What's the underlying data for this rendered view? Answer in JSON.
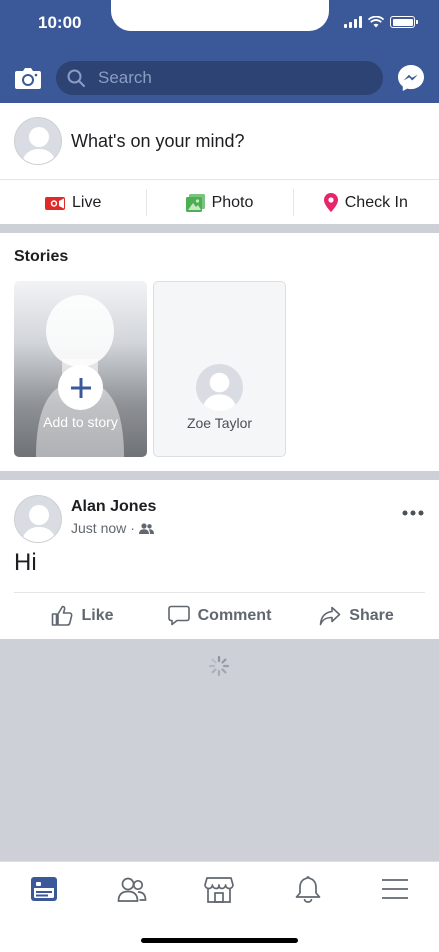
{
  "status_bar": {
    "time": "10:00"
  },
  "header": {
    "search_placeholder": "Search"
  },
  "composer": {
    "prompt": "What's on your mind?",
    "actions": [
      {
        "label": "Live",
        "icon": "video-camera-icon",
        "color": "#e02a2a"
      },
      {
        "label": "Photo",
        "icon": "photo-icon",
        "color": "#4caf50"
      },
      {
        "label": "Check In",
        "icon": "location-pin-icon",
        "color": "#e8246b"
      }
    ]
  },
  "stories": {
    "title": "Stories",
    "items": [
      {
        "label": "Add to story",
        "icon": "plus-icon"
      },
      {
        "label": "Zoe Taylor"
      }
    ]
  },
  "post": {
    "author": "Alan Jones",
    "timestamp": "Just now",
    "audience_icon": "friends-icon",
    "body": "Hi",
    "actions": [
      {
        "label": "Like",
        "icon": "like-icon"
      },
      {
        "label": "Comment",
        "icon": "comment-icon"
      },
      {
        "label": "Share",
        "icon": "share-icon"
      }
    ]
  },
  "tabbar": {
    "items": [
      {
        "icon": "news-feed-icon",
        "active": true
      },
      {
        "icon": "friends-icon",
        "active": false
      },
      {
        "icon": "marketplace-icon",
        "active": false
      },
      {
        "icon": "notifications-icon",
        "active": false
      },
      {
        "icon": "menu-icon",
        "active": false
      }
    ]
  },
  "colors": {
    "brand": "#3b5998",
    "search_bg": "#2d4373",
    "divider": "#cdd0d6"
  }
}
